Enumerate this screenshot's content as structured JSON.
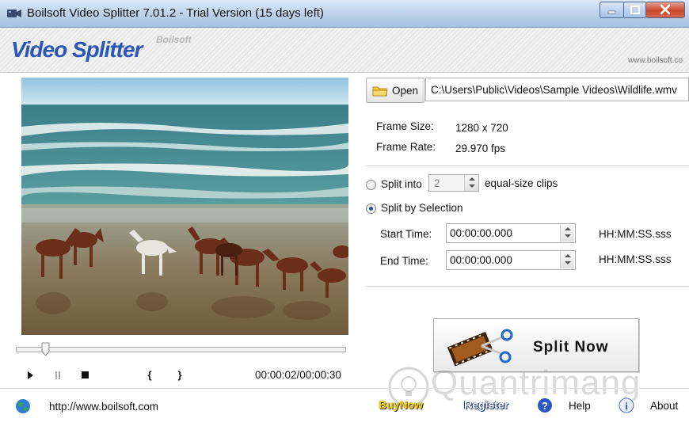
{
  "window": {
    "title": "Boilsoft Video Splitter 7.01.2 - Trial Version (15 days left)"
  },
  "banner": {
    "app_name": "Video Splitter",
    "brand": "Boilsoft",
    "website": "www.boilsoft.co"
  },
  "player": {
    "time_readout": "00:00:02/00:00:30",
    "seek_fraction": 0.09,
    "controls": {
      "play": "play-icon",
      "pause": "pause-icon",
      "stop": "stop-icon",
      "mark_in": "{",
      "mark_out": "}"
    }
  },
  "file": {
    "open_label": "Open",
    "path": "C:\\Users\\Public\\Videos\\Sample Videos\\Wildlife.wmv"
  },
  "info": {
    "frame_size_label": "Frame Size:",
    "frame_size_value": "1280 x 720",
    "frame_rate_label": "Frame Rate:",
    "frame_rate_value": "29.970 fps"
  },
  "split_options": {
    "split_into_label": "Split into",
    "split_into_value": "2",
    "split_into_suffix": "equal-size clips",
    "split_by_selection_label": "Split by Selection",
    "selected": "split_by_selection",
    "start_time_label": "Start Time:",
    "start_time_value": "00:00:00.000",
    "end_time_label": "End Time:",
    "end_time_value": "00:00:00.000",
    "time_format": "HH:MM:SS.sss"
  },
  "action": {
    "split_now_label": "Split Now"
  },
  "footer": {
    "url": "http://www.boilsoft.com",
    "buy_now": "BuyNow",
    "register": "Register",
    "help": "Help",
    "about": "About",
    "watermark": "Quantrimang"
  },
  "colors": {
    "logo_blue": "#2a56b8",
    "buy_now_yellow": "#ffd200",
    "close_red": "#c8452b"
  }
}
